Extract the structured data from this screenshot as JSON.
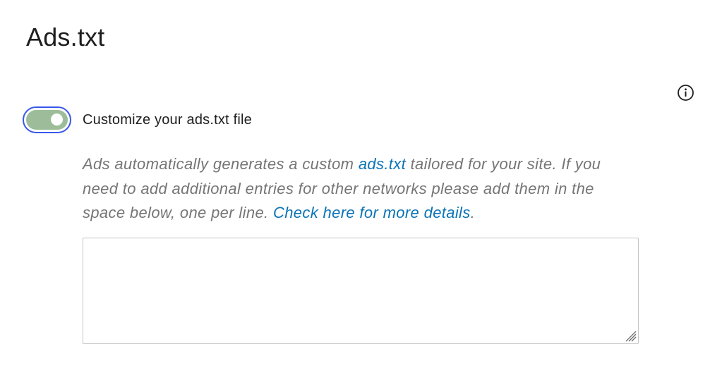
{
  "page": {
    "title": "Ads.txt"
  },
  "info": {
    "icon": "info-icon"
  },
  "toggle": {
    "label": "Customize your ads.txt file",
    "checked": true,
    "track_color": "#9dbd9a",
    "focus_ring_color": "#3858e9"
  },
  "help": {
    "text_before": "Ads automatically generates a custom ",
    "link1_text": "ads.txt",
    "text_middle": " tailored for your site. If you need to add additional entries for other networks please add them in the space below, one per line. ",
    "link2_text": "Check here for more details",
    "text_after": ".",
    "link_color": "#0a73b6"
  },
  "entries_field": {
    "value": "",
    "placeholder": ""
  }
}
